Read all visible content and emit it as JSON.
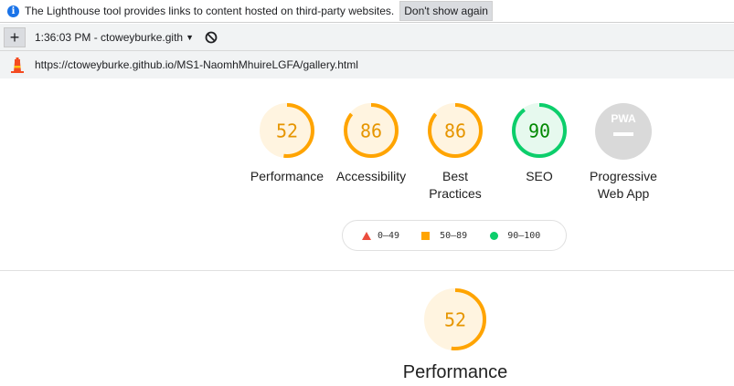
{
  "infobar": {
    "message": "The Lighthouse tool provides links to content hosted on third-party websites.",
    "dont_show_label": "Don't show again"
  },
  "toolbar": {
    "add_label": "+",
    "report_label": "1:36:03 PM - ctoweyburke.gith"
  },
  "urlbar": {
    "url": "https://ctoweyburke.github.io/MS1-NaomhMhuireLGFA/gallery.html"
  },
  "categories": [
    {
      "label": "Performance",
      "score": 52
    },
    {
      "label": "Accessibility",
      "score": 86
    },
    {
      "label": "Best Practices",
      "line1": "Best",
      "line2": "Practices",
      "score": 86
    },
    {
      "label": "SEO",
      "score": 90
    },
    {
      "label": "Progressive Web App",
      "line1": "Progressive",
      "line2": "Web App",
      "badge": "PWA"
    }
  ],
  "legend": {
    "fail": "0–49",
    "average": "50–89",
    "pass": "90–100"
  },
  "performance_section": {
    "score": 52,
    "title": "Performance"
  },
  "colors": {
    "fail": "#eb4d3d",
    "average": "#ffa400",
    "average_text": "#e69500",
    "average_bg": "#fff4e0",
    "pass": "#0cce6b",
    "pass_text": "#008800",
    "pass_bg": "#e6f9ee",
    "na": "#d9d9d9"
  }
}
